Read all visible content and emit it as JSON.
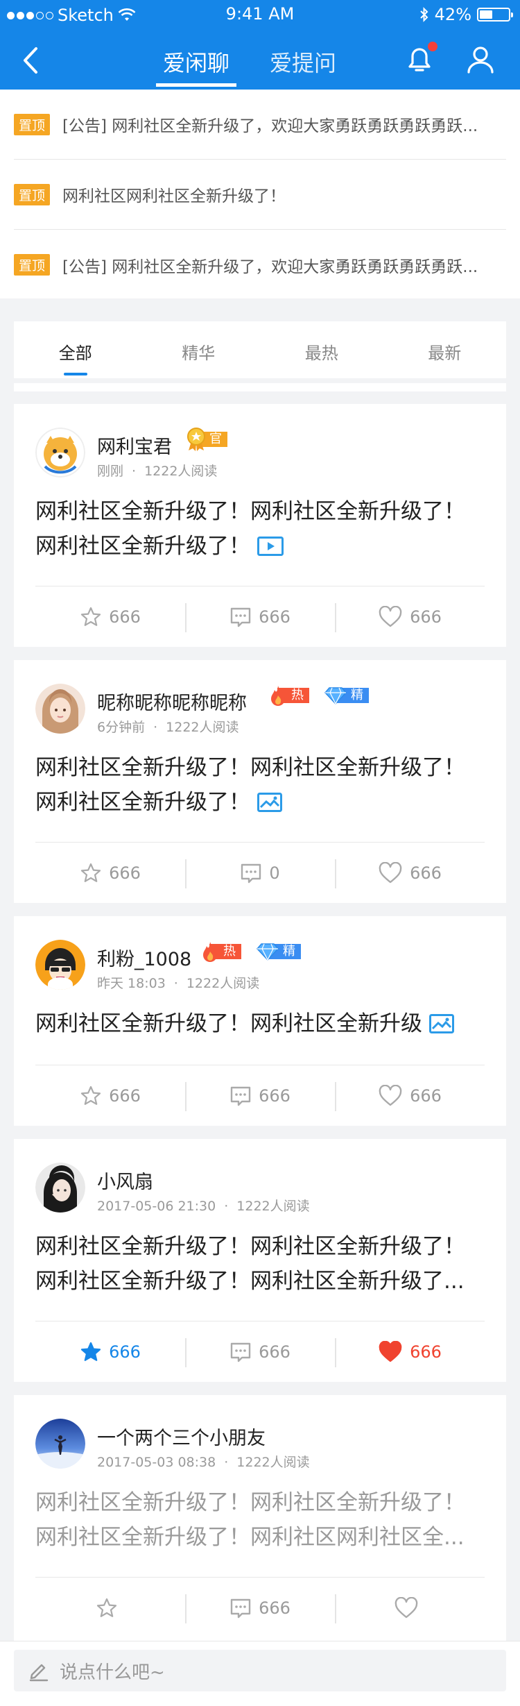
{
  "status_bar": {
    "carrier": "Sketch",
    "time": "9:41 AM",
    "battery": "42%"
  },
  "header": {
    "tabs": [
      {
        "label": "爱闲聊",
        "active": true
      },
      {
        "label": "爱提问",
        "active": false
      }
    ]
  },
  "notices": [
    {
      "badge": "置顶",
      "text": "[公告] 网利社区全新升级了，欢迎大家勇跃勇跃勇跃勇跃..."
    },
    {
      "badge": "置顶",
      "text": "网利社区网利社区全新升级了！"
    },
    {
      "badge": "置顶",
      "text": "[公告] 网利社区全新升级了，欢迎大家勇跃勇跃勇跃勇跃..."
    }
  ],
  "filter_tabs": [
    {
      "label": "全部",
      "active": true
    },
    {
      "label": "精华"
    },
    {
      "label": "最热"
    },
    {
      "label": "最新"
    }
  ],
  "posts": [
    {
      "user": "网利宝君",
      "badge_official": "官",
      "time": "刚刚",
      "reads": "1222人阅读",
      "text": "网利社区全新升级了！网利社区全新升级了！网利社区全新升级了！",
      "favorites": "666",
      "comments": "666",
      "likes": "666"
    },
    {
      "user": "昵称昵称昵称昵称",
      "badge_hot": "热",
      "badge_essence": "精",
      "time": "6分钟前",
      "reads": "1222人阅读",
      "text": "网利社区全新升级了！网利社区全新升级了！网利社区全新升级了！",
      "favorites": "666",
      "comments": "0",
      "likes": "666"
    },
    {
      "user": "利粉_1008",
      "badge_hot": "热",
      "badge_essence": "精",
      "time": "昨天 18:03",
      "reads": "1222人阅读",
      "text": "网利社区全新升级了！网利社区全新升级",
      "favorites": "666",
      "comments": "666",
      "likes": "666"
    },
    {
      "user": "小风扇",
      "time": "2017-05-06 21:30",
      "reads": "1222人阅读",
      "text": "网利社区全新升级了！网利社区全新升级了！网利社区全新升级了！网利社区全新升级了...",
      "favorites": "666",
      "comments": "666",
      "likes": "666"
    },
    {
      "user": "一个两个三个小朋友",
      "time": "2017-05-03 08:38",
      "reads": "1222人阅读",
      "text": "网利社区全新升级了！网利社区全新升级了！网利社区全新升级了！网利社区网利社区全...",
      "favorites": "",
      "comments": "666",
      "likes": ""
    }
  ],
  "comment_bar": {
    "placeholder": "说点什么吧~"
  },
  "colors": {
    "brand": "#1586e8",
    "pin": "#f5a623",
    "hot": "#f65538",
    "essence": "#3a8df2",
    "like_active": "#f0432f"
  }
}
